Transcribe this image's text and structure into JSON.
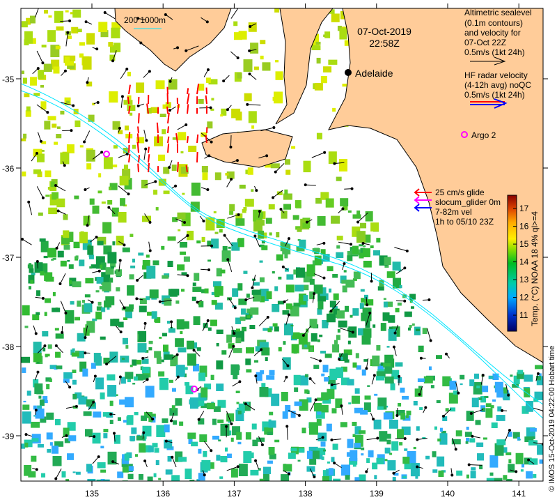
{
  "map": {
    "date": "07-Oct-2019",
    "time": "22:58Z",
    "scale_label": "200  1000m",
    "city": "Adelaide",
    "argo_label": "Argo 2",
    "lon_ticks": [
      "135",
      "136",
      "137",
      "138",
      "139",
      "140",
      "141"
    ],
    "lat_ticks": [
      "-35",
      "-36",
      "-37",
      "-38",
      "-39"
    ],
    "altimetry_legend": [
      "Altimetric sealevel",
      "(0.1m contours)",
      "and velocity for",
      "07-Oct 22Z",
      "0.5m/s (1kt 24h)"
    ],
    "hf_legend": [
      "HF radar velocity",
      "(4-12h avg) noQC",
      "0.5m/s (1kt 24h)"
    ],
    "glider_legend": [
      "25 cm/s glide",
      "slocum_glider 0m",
      "7-82m vel",
      "1h to 05/10 23Z"
    ],
    "colorbar": {
      "label": "Temp. (°C) NOAA 18 4% ql>=4",
      "ticks": [
        "11",
        "12",
        "13",
        "14",
        "15",
        "16",
        "17"
      ],
      "min": 10.1,
      "max": 17.75
    },
    "credit": "© IMOS 15-Oct-2019 04:22:00 Hobart time"
  },
  "colors": {
    "land": "#FFCC99",
    "glider_red": "#ff0000",
    "glider_magenta": "#ff00ff",
    "glider_blue": "#0000ff",
    "isobath": "#00e5ff"
  }
}
